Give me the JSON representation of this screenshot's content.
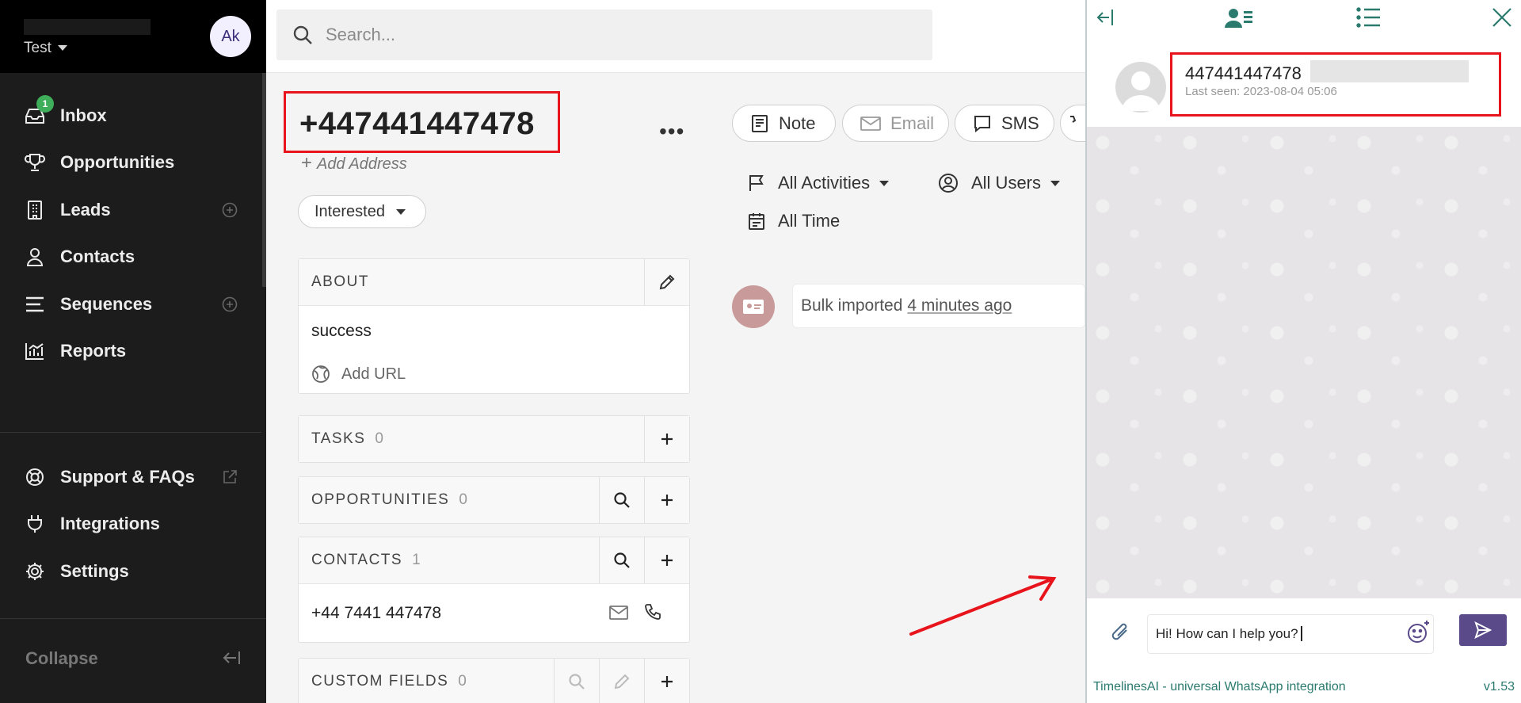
{
  "sidebar": {
    "workspace": "Test",
    "avatar_initials": "Ak",
    "inbox_badge": "1",
    "items": [
      {
        "label": "Inbox",
        "icon": "inbox-icon"
      },
      {
        "label": "Opportunities",
        "icon": "trophy-icon"
      },
      {
        "label": "Leads",
        "icon": "building-icon"
      },
      {
        "label": "Contacts",
        "icon": "person-icon"
      },
      {
        "label": "Sequences",
        "icon": "list-icon"
      },
      {
        "label": "Reports",
        "icon": "chart-icon"
      }
    ],
    "bottom_items": [
      {
        "label": "Support & FAQs",
        "icon": "lifebuoy-icon"
      },
      {
        "label": "Integrations",
        "icon": "plug-icon"
      },
      {
        "label": "Settings",
        "icon": "gear-icon"
      }
    ],
    "collapse_label": "Collapse"
  },
  "search": {
    "placeholder": "Search..."
  },
  "lead": {
    "title": "+447441447478",
    "add_address": "Add Address",
    "status": "Interested"
  },
  "about": {
    "header": "ABOUT",
    "value": "success",
    "add_url": "Add URL"
  },
  "tasks": {
    "header": "TASKS",
    "count": "0"
  },
  "opportunities": {
    "header": "OPPORTUNITIES",
    "count": "0"
  },
  "contacts": {
    "header": "CONTACTS",
    "count": "1",
    "phone": "+44 7441 447478"
  },
  "custom_fields": {
    "header": "CUSTOM FIELDS",
    "count": "0"
  },
  "activity": {
    "note": "Note",
    "email": "Email",
    "sms": "SMS",
    "filter_activities": "All Activities",
    "filter_users": "All Users",
    "filter_time": "All Time",
    "timeline_text": "Bulk imported",
    "timeline_ago": "4 minutes ago"
  },
  "whatsapp": {
    "contact_name": "447441447478",
    "last_seen": "Last seen: 2023-08-04 05:06",
    "message_value": "Hi! How can I help you?",
    "footer_brand": "TimelinesAI - universal WhatsApp integration",
    "version": "v1.53"
  },
  "colors": {
    "accent": "#5a4a8a",
    "highlight": "#e8141c",
    "badge": "#3fae5a",
    "brand_text": "#2a7a6e"
  }
}
